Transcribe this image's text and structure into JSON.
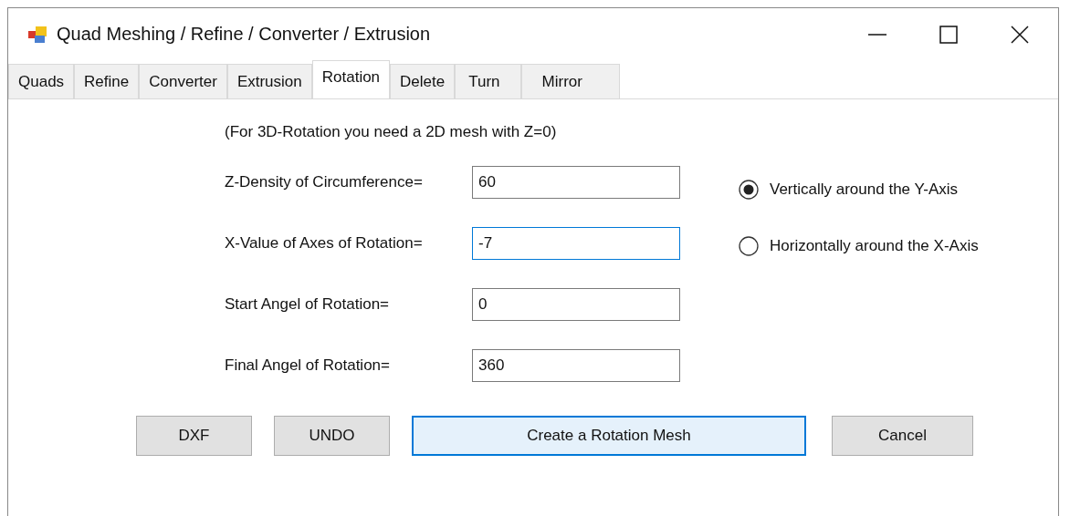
{
  "window": {
    "title": "Quad Meshing / Refine / Converter / Extrusion"
  },
  "tabs": [
    {
      "label": "Quads",
      "selected": false
    },
    {
      "label": "Refine",
      "selected": false
    },
    {
      "label": "Converter",
      "selected": false
    },
    {
      "label": "Extrusion",
      "selected": false
    },
    {
      "label": "Rotation",
      "selected": true
    },
    {
      "label": "Delete",
      "selected": false
    },
    {
      "label": "Turn",
      "selected": false
    },
    {
      "label": "Mirror",
      "selected": false
    }
  ],
  "note": "(For 3D-Rotation you need a 2D mesh with Z=0)",
  "fields": [
    {
      "label": "Z-Density of Circumference=",
      "value": "60",
      "focused": false
    },
    {
      "label": "X-Value of Axes of Rotation=",
      "value": "-7",
      "focused": true
    },
    {
      "label": "Start Angel of Rotation=",
      "value": "0",
      "focused": false
    },
    {
      "label": "Final Angel of Rotation=",
      "value": "360",
      "focused": false
    }
  ],
  "radios": [
    {
      "label": "Vertically around the Y-Axis",
      "selected": true
    },
    {
      "label": "Horizontally around the X-Axis",
      "selected": false
    }
  ],
  "buttons": [
    {
      "label": "DXF",
      "focused": false
    },
    {
      "label": "UNDO",
      "focused": false
    },
    {
      "label": "Create a Rotation Mesh",
      "focused": true
    },
    {
      "label": "Cancel",
      "focused": false
    }
  ]
}
